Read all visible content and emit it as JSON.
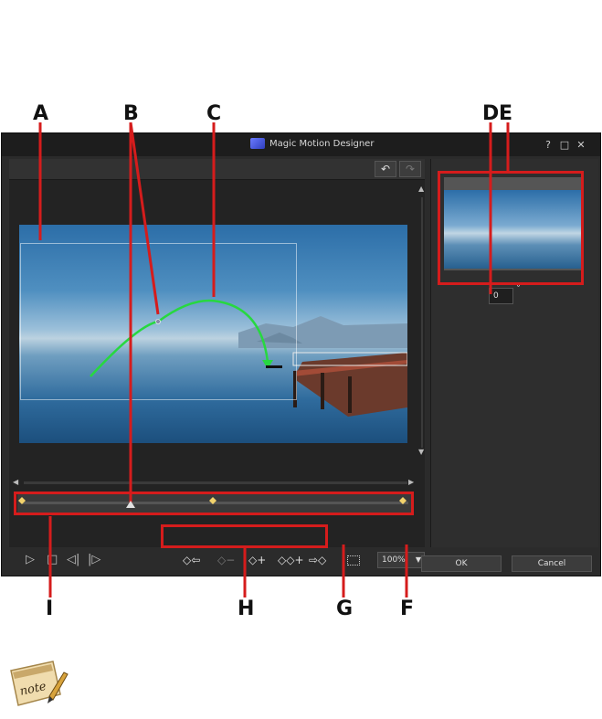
{
  "callouts": {
    "a": "A",
    "b": "B",
    "c": "C",
    "d": "D",
    "e": "E",
    "f": "F",
    "g": "G",
    "h": "H",
    "i": "I"
  },
  "window": {
    "title": "Magic Motion Designer",
    "help": "?",
    "maximize": "□",
    "close": "✕"
  },
  "toolbar": {
    "undo": "↶",
    "redo": "↷"
  },
  "keyframe_buttons": {
    "prev": "◇⇦",
    "remove": "◇−",
    "add": "◇+",
    "duplicate": "◇◇+",
    "next": "⇨◇"
  },
  "playback": {
    "play": "▷",
    "stop": "□",
    "prev_frame": "◁|",
    "next_frame": "|▷"
  },
  "zoom": {
    "value": "100%",
    "arrow": "▼"
  },
  "rotation": {
    "value": "0",
    "unit": "°"
  },
  "buttons": {
    "ok": "OK",
    "cancel": "Cancel"
  },
  "note_icon": {
    "text": "note"
  },
  "timeline": {
    "keyframe_positions": [
      0.0,
      0.48,
      1.0
    ],
    "playhead_position": 0.27
  },
  "colors": {
    "highlight": "#d51c1c",
    "motion_path": "#27d840",
    "keyframe": "#f2d26b"
  }
}
